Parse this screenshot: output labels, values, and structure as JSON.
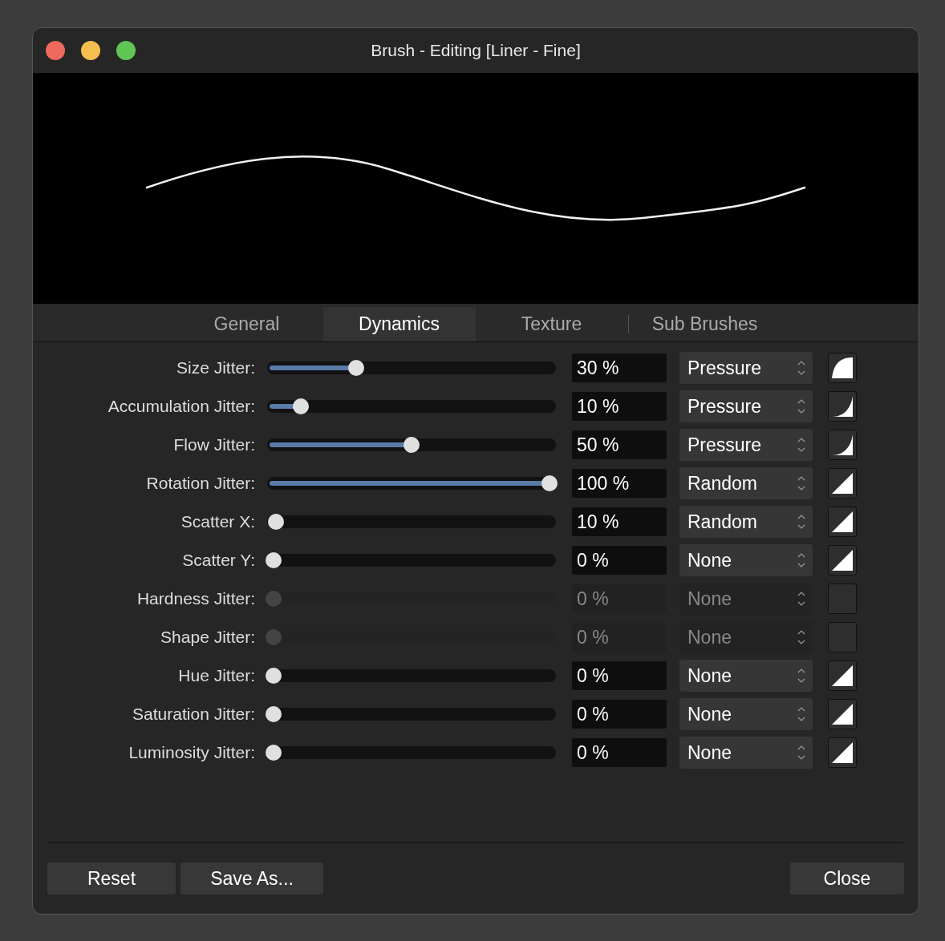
{
  "window": {
    "title": "Brush - Editing [Liner - Fine]"
  },
  "tabs": [
    {
      "label": "General",
      "selected": false
    },
    {
      "label": "Dynamics",
      "selected": true
    },
    {
      "label": "Texture",
      "selected": false
    },
    {
      "label": "Sub Brushes",
      "selected": false
    }
  ],
  "rows": [
    {
      "label": "Size Jitter:",
      "level": 0.3,
      "value": "30 %",
      "controller": "Pressure",
      "curve": {
        "kind": "convex"
      },
      "disabled": false
    },
    {
      "label": "Accumulation Jitter:",
      "level": 0.1,
      "value": "10 %",
      "controller": "Pressure",
      "curve": {
        "kind": "concave"
      },
      "disabled": false
    },
    {
      "label": "Flow Jitter:",
      "level": 0.5,
      "value": "50 %",
      "controller": "Pressure",
      "curve": {
        "kind": "concave"
      },
      "disabled": false
    },
    {
      "label": "Rotation Jitter:",
      "level": 1,
      "value": "100 %",
      "controller": "Random",
      "curve": {
        "kind": "linear"
      },
      "disabled": false
    },
    {
      "label": "Scatter X:",
      "level": 0.01,
      "value": "10 %",
      "controller": "Random",
      "curve": {
        "kind": "linear"
      },
      "disabled": false
    },
    {
      "label": "Scatter Y:",
      "level": 0,
      "value": "0 %",
      "controller": "None",
      "curve": {
        "kind": "linear"
      },
      "disabled": false
    },
    {
      "label": "Hardness Jitter:",
      "level": 0,
      "value": "0 %",
      "controller": "None",
      "disabled": true
    },
    {
      "label": "Shape Jitter:",
      "level": 0,
      "value": "0 %",
      "controller": "None",
      "disabled": true
    },
    {
      "label": "Hue Jitter:",
      "level": 0,
      "value": "0 %",
      "controller": "None",
      "curve": {
        "kind": "linear"
      },
      "disabled": false
    },
    {
      "label": "Saturation Jitter:",
      "level": 0,
      "value": "0 %",
      "controller": "None",
      "curve": {
        "kind": "linear"
      },
      "disabled": false
    },
    {
      "label": "Luminosity Jitter:",
      "level": 0,
      "value": "0 %",
      "controller": "None",
      "curve": {
        "kind": "linear"
      },
      "disabled": false
    }
  ],
  "buttons": {
    "left": [
      "Reset",
      "Save As..."
    ],
    "right": [
      "Close"
    ]
  }
}
